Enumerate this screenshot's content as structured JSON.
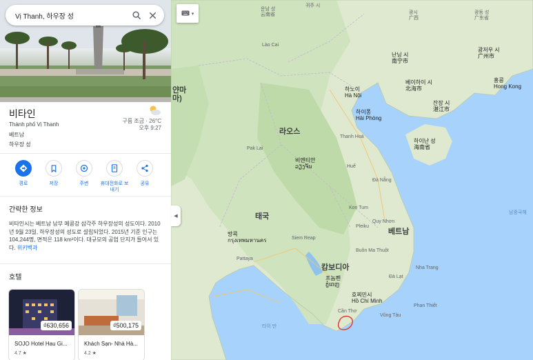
{
  "search": {
    "query": "Vị Thanh, 하우장 성"
  },
  "place": {
    "title": "비타인",
    "native_name": "Thành phố Vị Thanh",
    "country": "베트남",
    "province": "하우장 성",
    "weather": {
      "summary": "구름 조금 · 26°C",
      "time": "오후 9:27"
    }
  },
  "actions": [
    {
      "label": "경로",
      "icon": "directions-icon"
    },
    {
      "label": "저장",
      "icon": "bookmark-icon"
    },
    {
      "label": "주변",
      "icon": "nearby-icon"
    },
    {
      "label": "휴대전화로 보내기",
      "icon": "send-to-phone-icon"
    },
    {
      "label": "공유",
      "icon": "share-icon"
    }
  ],
  "overview": {
    "heading": "간략한 정보",
    "text": "비타인시는 베트남 남부 메콩강 삼각주 하우장성의 성도이다. 2010년 9월 23일, 하우장성의 성도로 설립되었다. 2015년 기준 인구는 104,244명, 면적은 118 km²이다. 대규모의 공업 단지가 들어서 있다.",
    "link": "위키백과"
  },
  "hotels": {
    "heading": "호텔",
    "items": [
      {
        "price": "₫630,656",
        "name": "SOJO Hotel Hau Gi...",
        "rating": "4.7 ★"
      },
      {
        "price": "₫500,175",
        "name": "Khách Sạn- Nhà Hà...",
        "rating": "4.2 ★"
      }
    ]
  },
  "map_labels": {
    "yunnan": "운남 성",
    "yunnan_cn": "云南省",
    "guangxi": "광시",
    "guangxi_cn": "广西",
    "guizhou_n": "귀주 시",
    "guangdong": "광동 성",
    "guangdong_cn": "广东省",
    "nanning": "난닝 시",
    "nanning_cn": "南宁市",
    "guangzhou": "광저우 시",
    "guangzhou_cn": "广州市",
    "beihai": "베이하이 시",
    "beihai_cn": "北海市",
    "zhanjiang": "잔장 시",
    "zhanjiang_cn": "湛江市",
    "hongkong": "홍콩",
    "hongkong_en": "Hong Kong",
    "hainan": "하이난 성",
    "hainan_cn": "海南省",
    "myanmar": "얀마",
    "myanmar_local": "마)",
    "hanoi": "하노이",
    "hanoi_vn": "Hà Nội",
    "haiphong": "하이퐁",
    "haiphong_vn": "Hải Phòng",
    "thanhhoa": "Thanh Hoá",
    "laos": "라오스",
    "vientiane": "비엔티안",
    "vientiane_local": "ວຽງຈັນ",
    "thailand": "태국",
    "bangkok": "방콕",
    "bangkok_th": "กรุงเทพมหานคร",
    "cambodia": "캄보디아",
    "phnompenh": "프놈펜",
    "phnompenh_km": "ភ្នំពេញ",
    "vietnam": "베트남",
    "hcmc": "호찌민시",
    "hcmc_vn": "Hồ Chí Minh",
    "cantho": "Cần Thơ",
    "vungtau": "Vũng Tàu",
    "phanthiet": "Phan Thiết",
    "nhatrang": "Nha Trang",
    "quynhon": "Quy Nhơn",
    "danang": "Đà Nẵng",
    "hue": "Huế",
    "southchinasea": "남중국해",
    "gulfthailand": "타이 만",
    "laocai": "Lào Cai",
    "paklay": "Pak Lai",
    "pattaya": "Pattaya",
    "siemreap": "Siem Reap",
    "pleiku": "Pleiku",
    "kontum": "Kon Tum",
    "buonmathuot": "Buôn Ma Thuột",
    "dalat": "Đà Lạt"
  },
  "colors": {
    "accent": "#1a73e8",
    "land": "#e8efdc",
    "forest": "#c4deb2",
    "water": "#a7d2fb",
    "marker": "#e53935"
  }
}
